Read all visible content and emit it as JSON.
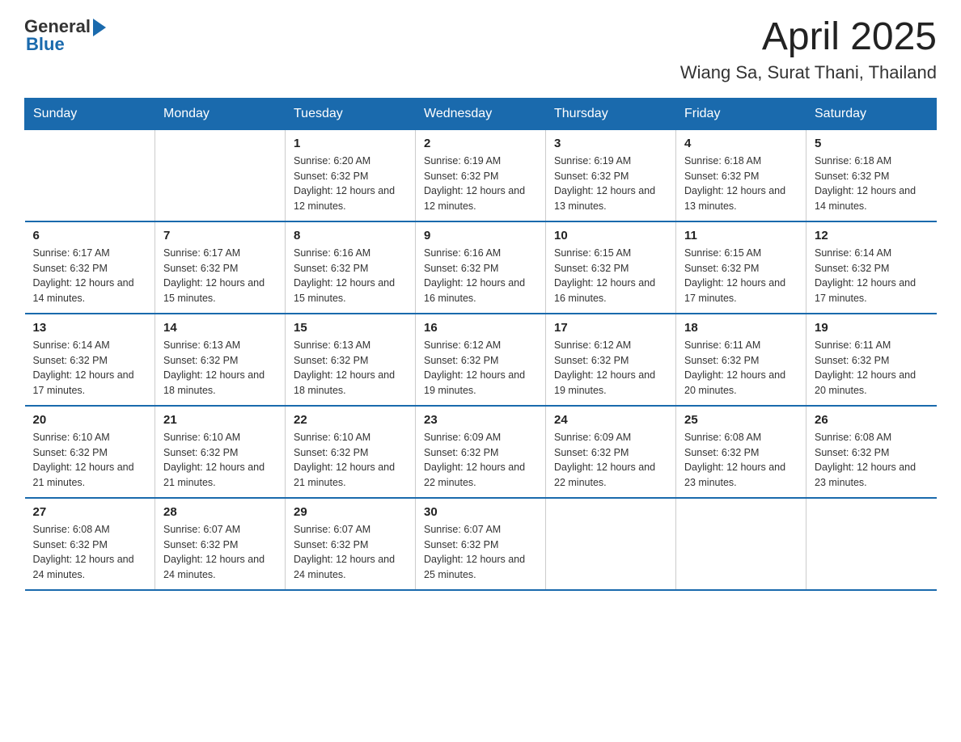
{
  "header": {
    "logo_general": "General",
    "logo_blue": "Blue",
    "title": "April 2025",
    "subtitle": "Wiang Sa, Surat Thani, Thailand"
  },
  "calendar": {
    "days_of_week": [
      "Sunday",
      "Monday",
      "Tuesday",
      "Wednesday",
      "Thursday",
      "Friday",
      "Saturday"
    ],
    "weeks": [
      [
        {
          "day": "",
          "sunrise": "",
          "sunset": "",
          "daylight": ""
        },
        {
          "day": "",
          "sunrise": "",
          "sunset": "",
          "daylight": ""
        },
        {
          "day": "1",
          "sunrise": "Sunrise: 6:20 AM",
          "sunset": "Sunset: 6:32 PM",
          "daylight": "Daylight: 12 hours and 12 minutes."
        },
        {
          "day": "2",
          "sunrise": "Sunrise: 6:19 AM",
          "sunset": "Sunset: 6:32 PM",
          "daylight": "Daylight: 12 hours and 12 minutes."
        },
        {
          "day": "3",
          "sunrise": "Sunrise: 6:19 AM",
          "sunset": "Sunset: 6:32 PM",
          "daylight": "Daylight: 12 hours and 13 minutes."
        },
        {
          "day": "4",
          "sunrise": "Sunrise: 6:18 AM",
          "sunset": "Sunset: 6:32 PM",
          "daylight": "Daylight: 12 hours and 13 minutes."
        },
        {
          "day": "5",
          "sunrise": "Sunrise: 6:18 AM",
          "sunset": "Sunset: 6:32 PM",
          "daylight": "Daylight: 12 hours and 14 minutes."
        }
      ],
      [
        {
          "day": "6",
          "sunrise": "Sunrise: 6:17 AM",
          "sunset": "Sunset: 6:32 PM",
          "daylight": "Daylight: 12 hours and 14 minutes."
        },
        {
          "day": "7",
          "sunrise": "Sunrise: 6:17 AM",
          "sunset": "Sunset: 6:32 PM",
          "daylight": "Daylight: 12 hours and 15 minutes."
        },
        {
          "day": "8",
          "sunrise": "Sunrise: 6:16 AM",
          "sunset": "Sunset: 6:32 PM",
          "daylight": "Daylight: 12 hours and 15 minutes."
        },
        {
          "day": "9",
          "sunrise": "Sunrise: 6:16 AM",
          "sunset": "Sunset: 6:32 PM",
          "daylight": "Daylight: 12 hours and 16 minutes."
        },
        {
          "day": "10",
          "sunrise": "Sunrise: 6:15 AM",
          "sunset": "Sunset: 6:32 PM",
          "daylight": "Daylight: 12 hours and 16 minutes."
        },
        {
          "day": "11",
          "sunrise": "Sunrise: 6:15 AM",
          "sunset": "Sunset: 6:32 PM",
          "daylight": "Daylight: 12 hours and 17 minutes."
        },
        {
          "day": "12",
          "sunrise": "Sunrise: 6:14 AM",
          "sunset": "Sunset: 6:32 PM",
          "daylight": "Daylight: 12 hours and 17 minutes."
        }
      ],
      [
        {
          "day": "13",
          "sunrise": "Sunrise: 6:14 AM",
          "sunset": "Sunset: 6:32 PM",
          "daylight": "Daylight: 12 hours and 17 minutes."
        },
        {
          "day": "14",
          "sunrise": "Sunrise: 6:13 AM",
          "sunset": "Sunset: 6:32 PM",
          "daylight": "Daylight: 12 hours and 18 minutes."
        },
        {
          "day": "15",
          "sunrise": "Sunrise: 6:13 AM",
          "sunset": "Sunset: 6:32 PM",
          "daylight": "Daylight: 12 hours and 18 minutes."
        },
        {
          "day": "16",
          "sunrise": "Sunrise: 6:12 AM",
          "sunset": "Sunset: 6:32 PM",
          "daylight": "Daylight: 12 hours and 19 minutes."
        },
        {
          "day": "17",
          "sunrise": "Sunrise: 6:12 AM",
          "sunset": "Sunset: 6:32 PM",
          "daylight": "Daylight: 12 hours and 19 minutes."
        },
        {
          "day": "18",
          "sunrise": "Sunrise: 6:11 AM",
          "sunset": "Sunset: 6:32 PM",
          "daylight": "Daylight: 12 hours and 20 minutes."
        },
        {
          "day": "19",
          "sunrise": "Sunrise: 6:11 AM",
          "sunset": "Sunset: 6:32 PM",
          "daylight": "Daylight: 12 hours and 20 minutes."
        }
      ],
      [
        {
          "day": "20",
          "sunrise": "Sunrise: 6:10 AM",
          "sunset": "Sunset: 6:32 PM",
          "daylight": "Daylight: 12 hours and 21 minutes."
        },
        {
          "day": "21",
          "sunrise": "Sunrise: 6:10 AM",
          "sunset": "Sunset: 6:32 PM",
          "daylight": "Daylight: 12 hours and 21 minutes."
        },
        {
          "day": "22",
          "sunrise": "Sunrise: 6:10 AM",
          "sunset": "Sunset: 6:32 PM",
          "daylight": "Daylight: 12 hours and 21 minutes."
        },
        {
          "day": "23",
          "sunrise": "Sunrise: 6:09 AM",
          "sunset": "Sunset: 6:32 PM",
          "daylight": "Daylight: 12 hours and 22 minutes."
        },
        {
          "day": "24",
          "sunrise": "Sunrise: 6:09 AM",
          "sunset": "Sunset: 6:32 PM",
          "daylight": "Daylight: 12 hours and 22 minutes."
        },
        {
          "day": "25",
          "sunrise": "Sunrise: 6:08 AM",
          "sunset": "Sunset: 6:32 PM",
          "daylight": "Daylight: 12 hours and 23 minutes."
        },
        {
          "day": "26",
          "sunrise": "Sunrise: 6:08 AM",
          "sunset": "Sunset: 6:32 PM",
          "daylight": "Daylight: 12 hours and 23 minutes."
        }
      ],
      [
        {
          "day": "27",
          "sunrise": "Sunrise: 6:08 AM",
          "sunset": "Sunset: 6:32 PM",
          "daylight": "Daylight: 12 hours and 24 minutes."
        },
        {
          "day": "28",
          "sunrise": "Sunrise: 6:07 AM",
          "sunset": "Sunset: 6:32 PM",
          "daylight": "Daylight: 12 hours and 24 minutes."
        },
        {
          "day": "29",
          "sunrise": "Sunrise: 6:07 AM",
          "sunset": "Sunset: 6:32 PM",
          "daylight": "Daylight: 12 hours and 24 minutes."
        },
        {
          "day": "30",
          "sunrise": "Sunrise: 6:07 AM",
          "sunset": "Sunset: 6:32 PM",
          "daylight": "Daylight: 12 hours and 25 minutes."
        },
        {
          "day": "",
          "sunrise": "",
          "sunset": "",
          "daylight": ""
        },
        {
          "day": "",
          "sunrise": "",
          "sunset": "",
          "daylight": ""
        },
        {
          "day": "",
          "sunrise": "",
          "sunset": "",
          "daylight": ""
        }
      ]
    ]
  }
}
